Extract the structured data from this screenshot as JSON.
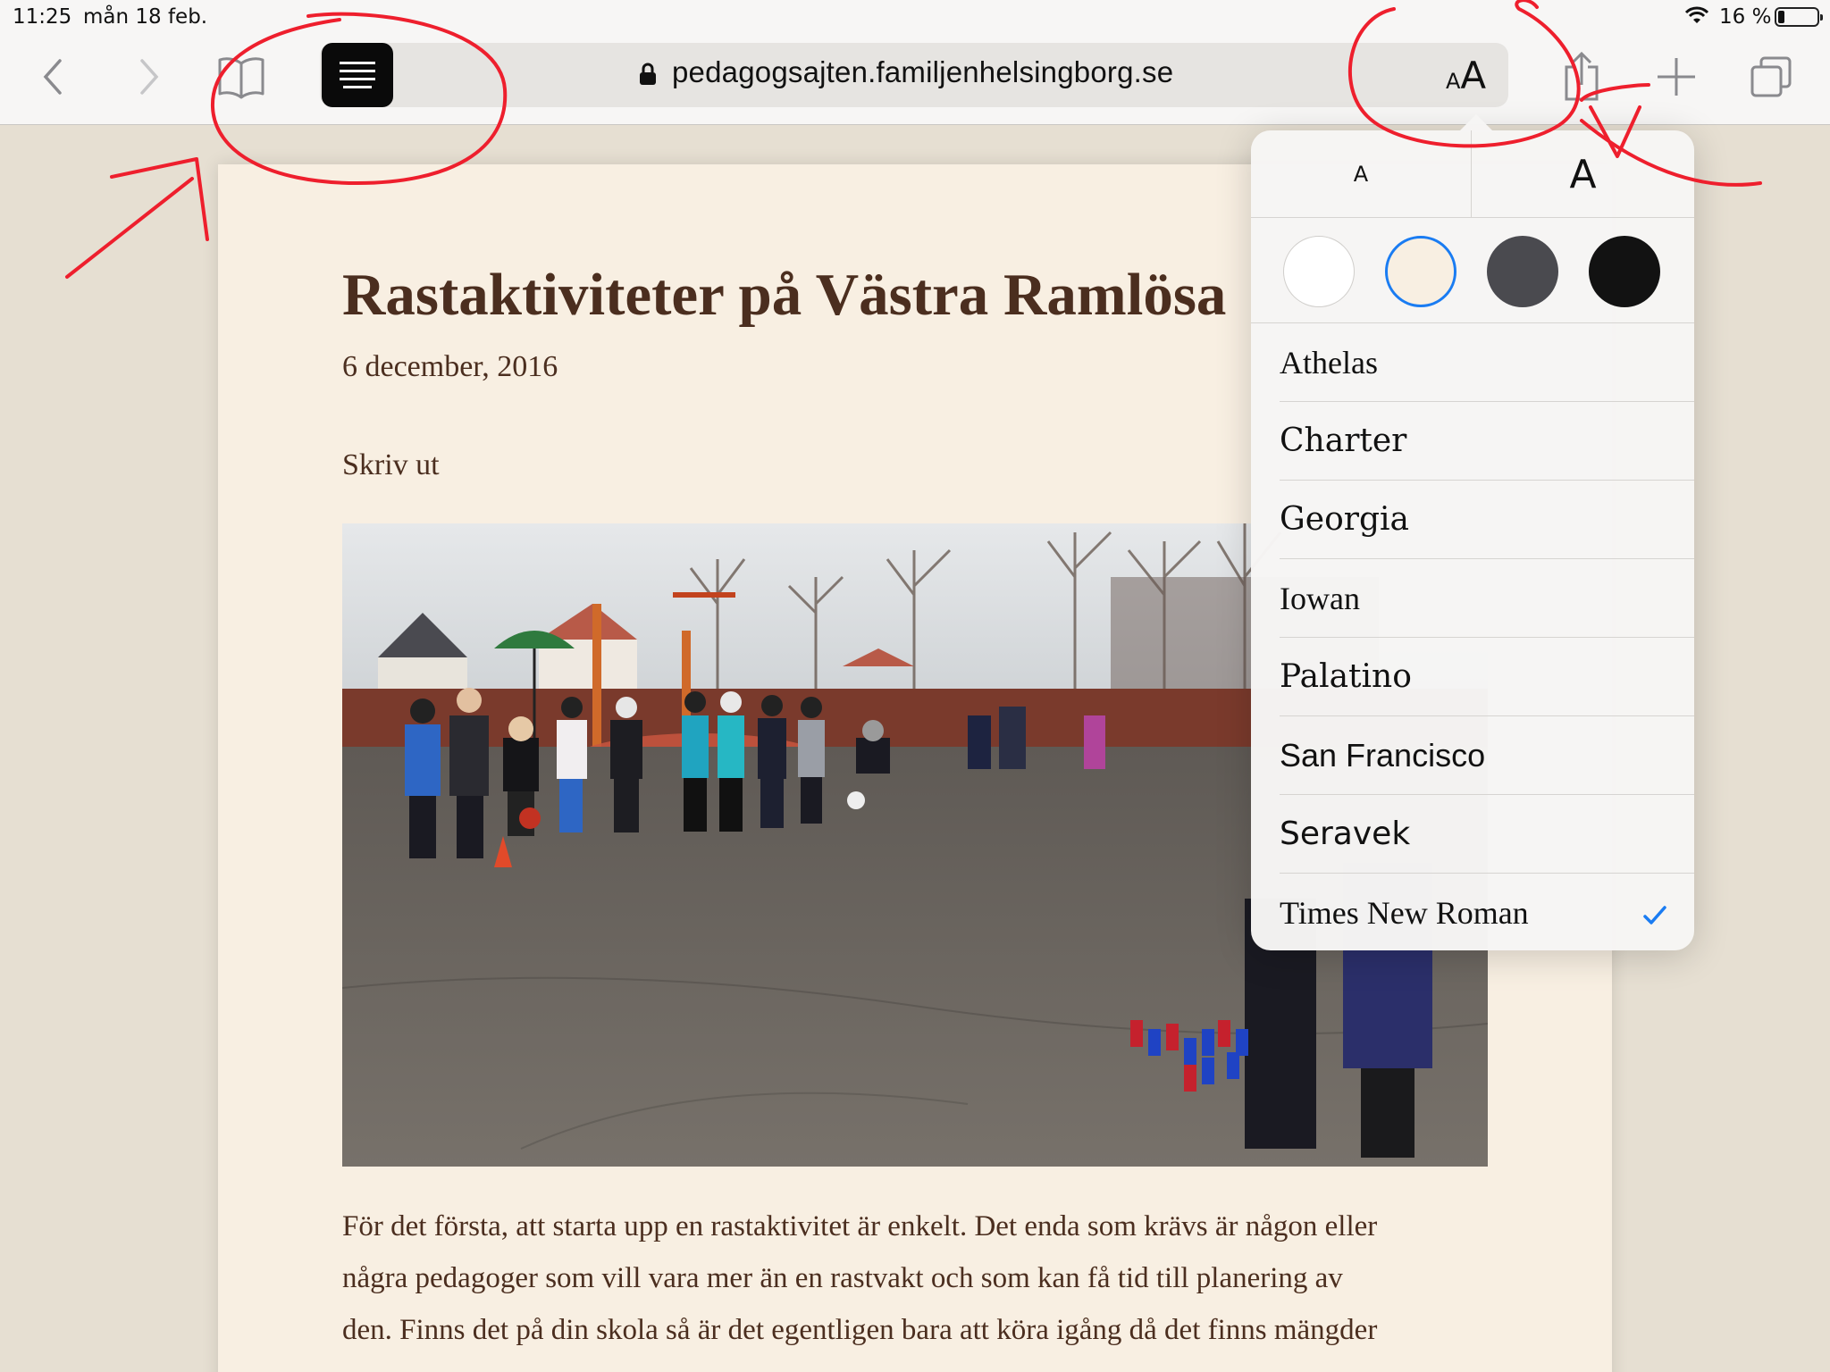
{
  "status_bar": {
    "time": "11:25",
    "date": "mån 18 feb.",
    "battery": "16 %",
    "battery_level": 0.16
  },
  "toolbar": {
    "url": "pedagogsajten.familjenhelsingborg.se",
    "text_size_small": "A",
    "text_size_large": "A",
    "icons": [
      "back-icon",
      "forward-icon",
      "bookmarks-icon",
      "reader-view-icon",
      "lock-icon",
      "text-settings-icon",
      "share-icon",
      "add-tab-icon",
      "tabs-icon"
    ]
  },
  "article": {
    "title": "Rastaktiviteter på Västra Ramlösa",
    "date": "6 december, 2016",
    "print_link": "Skriv ut",
    "body_lines": [
      "För det första, att starta upp en rastaktivitet är enkelt. Det enda som krävs är någon eller",
      "några pedagoger som vill vara mer än en rastvakt och som kan få tid till planering av",
      "den. Finns det på din skola så är det egentligen bara att köra igång då det finns mängder"
    ]
  },
  "reader_settings": {
    "size_decrease": "A",
    "size_increase": "A",
    "themes": [
      {
        "name": "white",
        "color": "#ffffff",
        "selected": false
      },
      {
        "name": "sepia",
        "color": "#f8efe2",
        "selected": true
      },
      {
        "name": "gray",
        "color": "#4a4a4f",
        "selected": false
      },
      {
        "name": "black",
        "color": "#121212",
        "selected": false
      }
    ],
    "accent": "#1a7cf2",
    "fonts": [
      {
        "label": "Athelas",
        "selected": false
      },
      {
        "label": "Charter",
        "selected": false
      },
      {
        "label": "Georgia",
        "selected": false
      },
      {
        "label": "Iowan",
        "selected": false
      },
      {
        "label": "Palatino",
        "selected": false
      },
      {
        "label": "San Francisco",
        "selected": false
      },
      {
        "label": "Seravek",
        "selected": false
      },
      {
        "label": "Times New Roman",
        "selected": true
      }
    ]
  },
  "annotations": {
    "ink_color": "#ee1f2d"
  }
}
